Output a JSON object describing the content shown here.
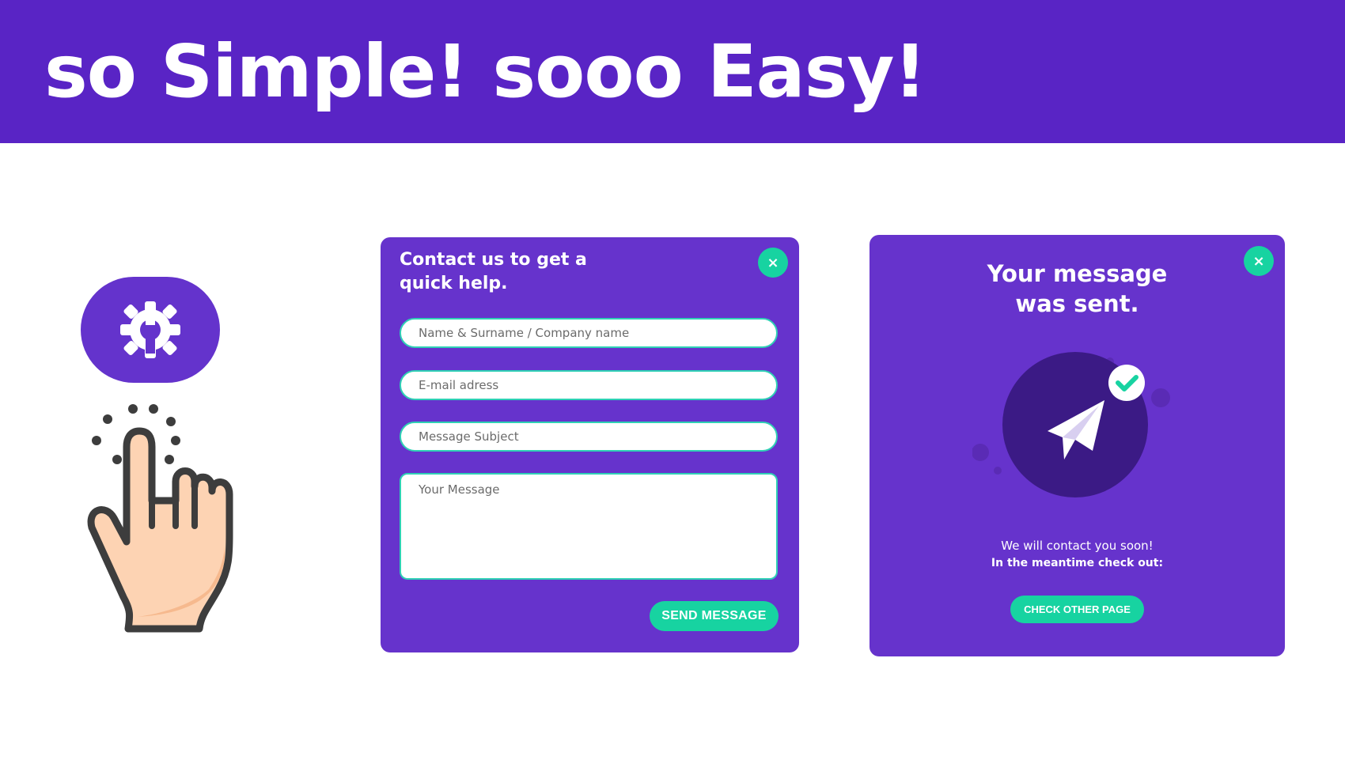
{
  "header": {
    "title": "so Simple! sooo Easy!"
  },
  "contact_form": {
    "title_line1": "Contact us to get a",
    "title_line2": "quick help.",
    "close_icon": "×",
    "fields": {
      "name_placeholder": "Name & Surname / Company name",
      "email_placeholder": "E-mail adress",
      "subject_placeholder": "Message Subject",
      "message_placeholder": "Your Message"
    },
    "send_label": "SEND MESSAGE"
  },
  "sent_dialog": {
    "title_line1": "Your message",
    "title_line2": "was sent.",
    "close_icon": "×",
    "text_line1": "We will contact you soon!",
    "text_line2": "In the meantime check out:",
    "cta_label": "CHECK OTHER PAGE"
  },
  "icons": {
    "settings": "gear-wrench-icon",
    "hand": "pointing-hand-icon",
    "plane": "paper-plane-icon",
    "check": "checkmark-icon"
  },
  "colors": {
    "banner": "#5924c5",
    "card": "#6633cc",
    "accent": "#17d3a1",
    "circle_dark": "#3b1a85"
  }
}
